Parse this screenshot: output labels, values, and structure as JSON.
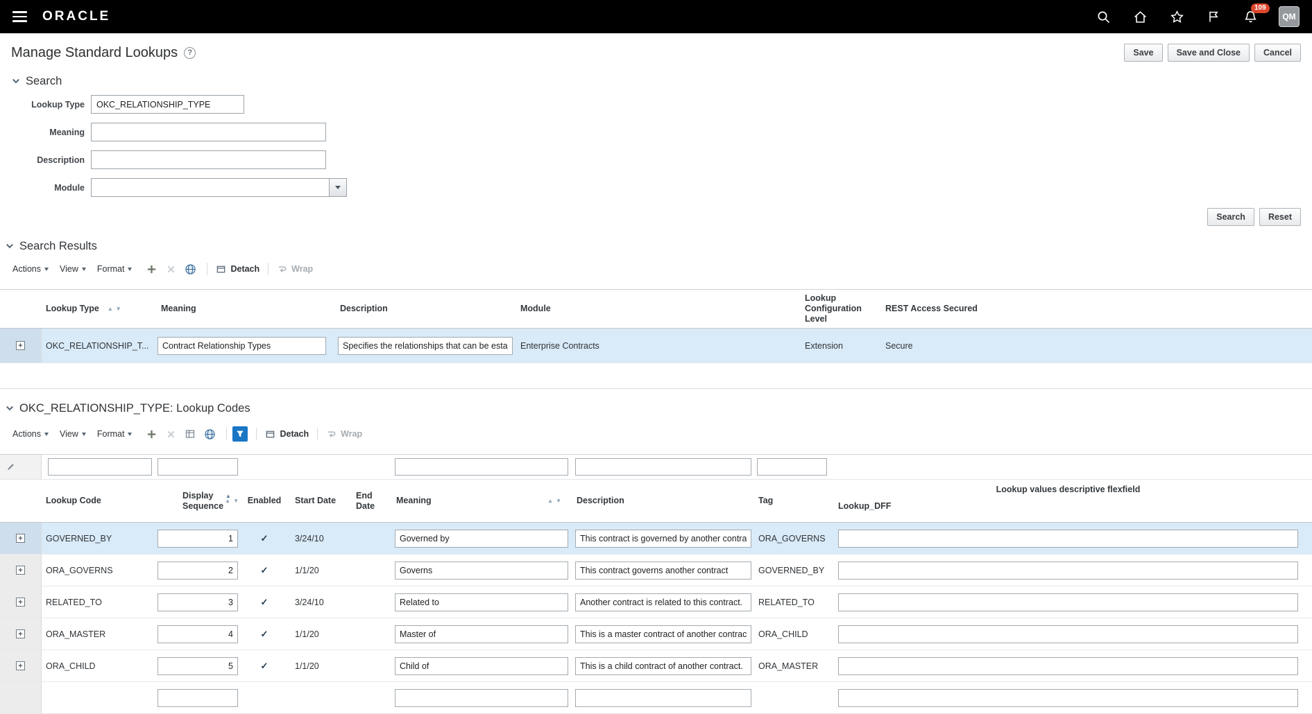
{
  "topbar": {
    "brand": "ORACLE",
    "notification_count": "109",
    "avatar_initials": "QM"
  },
  "page": {
    "title": "Manage Standard Lookups",
    "actions": {
      "save": "Save",
      "save_and_close": "Save and Close",
      "cancel": "Cancel"
    }
  },
  "search": {
    "title": "Search",
    "fields": {
      "lookup_type": {
        "label": "Lookup Type",
        "value": "OKC_RELATIONSHIP_TYPE"
      },
      "meaning": {
        "label": "Meaning",
        "value": ""
      },
      "description": {
        "label": "Description",
        "value": ""
      },
      "module": {
        "label": "Module",
        "value": ""
      }
    },
    "buttons": {
      "search": "Search",
      "reset": "Reset"
    }
  },
  "results": {
    "title": "Search Results",
    "toolbar": {
      "actions": "Actions",
      "view": "View",
      "format": "Format",
      "detach": "Detach",
      "wrap": "Wrap"
    },
    "columns": {
      "lookup_type": "Lookup Type",
      "meaning": "Meaning",
      "description": "Description",
      "module": "Module",
      "config_level": "Lookup Configuration Level",
      "rest": "REST Access Secured"
    },
    "rows": [
      {
        "lookup_type": "OKC_RELATIONSHIP_T...",
        "meaning": "Contract Relationship Types",
        "description": "Specifies the relationships that can be establ",
        "module": "Enterprise Contracts",
        "config_level": "Extension",
        "rest": "Secure",
        "selected": true
      }
    ]
  },
  "codes": {
    "title": "OKC_RELATIONSHIP_TYPE: Lookup Codes",
    "toolbar": {
      "actions": "Actions",
      "view": "View",
      "format": "Format",
      "detach": "Detach",
      "wrap": "Wrap"
    },
    "group_header": "Lookup values descriptive flexfield",
    "columns": {
      "code": "Lookup Code",
      "seq": "Display Sequence",
      "enabled": "Enabled",
      "start": "Start Date",
      "end": "End Date",
      "meaning": "Meaning",
      "description": "Description",
      "tag": "Tag",
      "dff": "Lookup_DFF"
    },
    "qbe": {
      "code": "",
      "seq": "",
      "meaning": "",
      "description": "",
      "tag": ""
    },
    "rows": [
      {
        "code": "GOVERNED_BY",
        "seq": "1",
        "enabled": "✓",
        "start": "3/24/10",
        "end": "",
        "meaning": "Governed by",
        "description": "This contract is governed by another contrac",
        "tag": "ORA_GOVERNS",
        "dff": "",
        "selected": true
      },
      {
        "code": "ORA_GOVERNS",
        "seq": "2",
        "enabled": "✓",
        "start": "1/1/20",
        "end": "",
        "meaning": "Governs",
        "description": "This contract governs another contract",
        "tag": "GOVERNED_BY",
        "dff": ""
      },
      {
        "code": "RELATED_TO",
        "seq": "3",
        "enabled": "✓",
        "start": "3/24/10",
        "end": "",
        "meaning": "Related to",
        "description": "Another contract is related to this contract.",
        "tag": "RELATED_TO",
        "dff": ""
      },
      {
        "code": "ORA_MASTER",
        "seq": "4",
        "enabled": "✓",
        "start": "1/1/20",
        "end": "",
        "meaning": "Master of",
        "description": "This is a master contract of another contract.",
        "tag": "ORA_CHILD",
        "dff": ""
      },
      {
        "code": "ORA_CHILD",
        "seq": "5",
        "enabled": "✓",
        "start": "1/1/20",
        "end": "",
        "meaning": "Child of",
        "description": "This is a child contract of another contract.",
        "tag": "ORA_MASTER",
        "dff": ""
      },
      {
        "code": "",
        "seq": "",
        "enabled": "",
        "start": "",
        "end": "",
        "meaning": "",
        "description": "",
        "tag": "",
        "dff": "",
        "partial": true
      }
    ]
  },
  "colors": {
    "accent_blue": "#1976c5",
    "selected_row": "#d9eaf8",
    "badge_red": "#dc472e",
    "topbar_bg": "#000000"
  }
}
